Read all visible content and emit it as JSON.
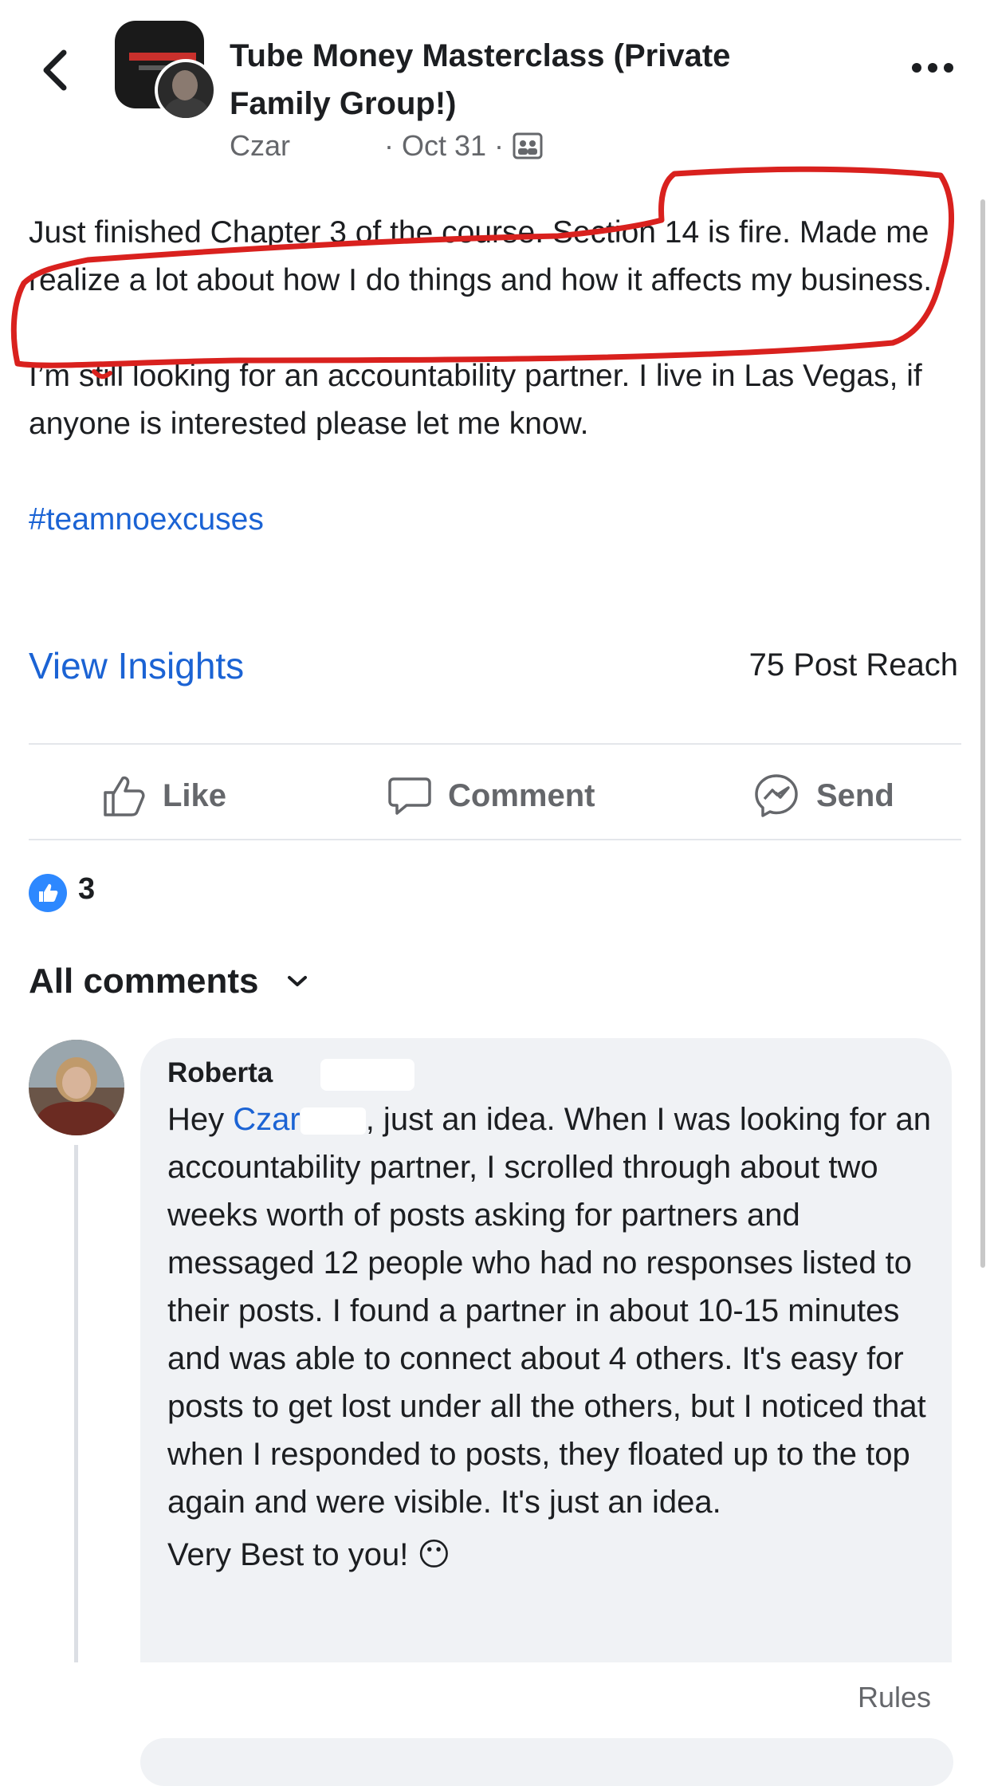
{
  "header": {
    "group_title": "Tube Money Masterclass (Private Family Group!)",
    "author": "Czar",
    "date": "· Oct 31 ·",
    "icons": [
      "back-icon",
      "more-icon",
      "group-privacy-icon"
    ]
  },
  "post": {
    "paragraph1": "Just finished Chapter 3 of the course. Section 14 is fire. Made me realize a lot about how I do things and how it affects my business.",
    "paragraph2": "I’m still looking for an accountability partner. I live in Las Vegas, if anyone is interested please let me know.",
    "hashtag": "#teamnoexcuses",
    "view_insights": "View Insights",
    "post_reach": "75 Post Reach"
  },
  "actions": {
    "like": "Like",
    "comment": "Comment",
    "send": "Send"
  },
  "reactions": {
    "count": "3",
    "icon": "like-reaction-icon",
    "color": "#2d88ff"
  },
  "comments": {
    "filter_label": "All comments",
    "items": [
      {
        "name": "Roberta",
        "text_before_mention": "Hey ",
        "mention": "Czar",
        "text_after_mention": ", just an idea. When I was looking for an accountability partner, I scrolled through about two weeks worth of posts asking for partners and messaged 12 people who had no responses listed to their posts. I found a partner in about 10-15 minutes and was able to connect about 4 others. It's easy for posts to get lost under all the others, but I noticed that when I responded to posts, they floated up to the top again and were visible. It's just an idea.",
        "sign_off": "Very Best to you! 😶"
      }
    ]
  },
  "footer": {
    "rules": "Rules"
  },
  "colors": {
    "link": "#1b63d4",
    "annotation": "#d9211e",
    "secondary_text": "#65676b"
  }
}
